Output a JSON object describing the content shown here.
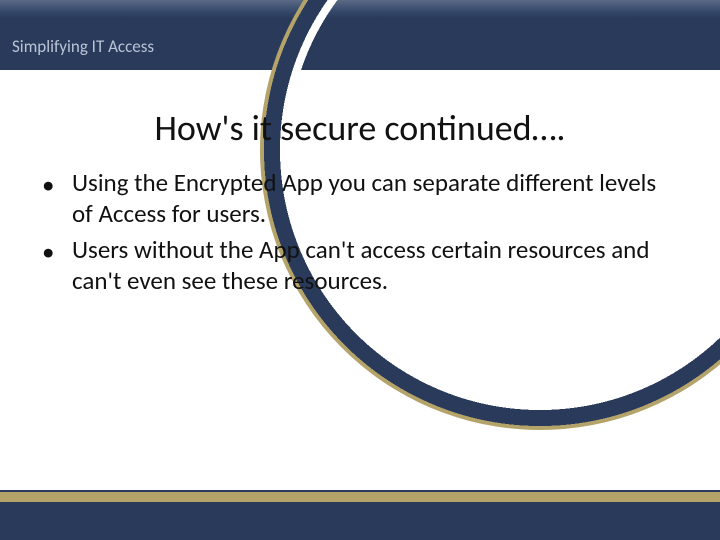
{
  "header": {
    "label": "Simplifying IT Access"
  },
  "title": "How's it secure continued….",
  "bullets": [
    "Using the Encrypted App you can separate different levels of Access for users.",
    "Users without the App can't access certain resources and can't even see these resources."
  ],
  "colors": {
    "navy": "#2a3a5a",
    "tan": "#b5a46a"
  }
}
